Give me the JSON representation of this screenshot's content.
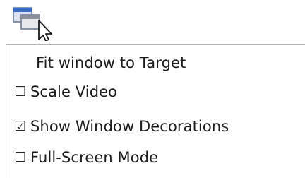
{
  "toolbar": {
    "window_icon": "window-layout-icon",
    "cursor_icon": "mouse-pointer-icon"
  },
  "menu": {
    "items": [
      {
        "label": "Fit window to Target",
        "checkable": false
      },
      {
        "label": "Scale Video",
        "check_glyph": "☐",
        "checked": false
      },
      {
        "label": "Show Window Decorations",
        "check_glyph": "☑",
        "checked": true
      },
      {
        "label": "Full-Screen Mode",
        "check_glyph": "☐",
        "checked": false
      }
    ]
  },
  "colors": {
    "icon_blue": "#3a6bc6",
    "icon_gray": "#8a8f98",
    "menu_border": "#b4b4b4"
  }
}
